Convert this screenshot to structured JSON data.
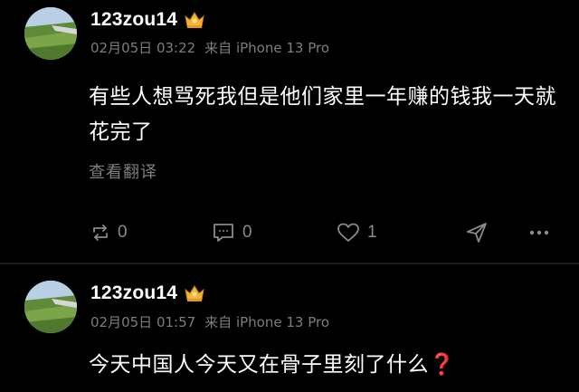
{
  "posts": [
    {
      "username": "123zou14",
      "date": "02月05日 03:22",
      "source": "来自 iPhone 13 Pro",
      "content": "有些人想骂死我但是他们家里一年赚的钱我一天就花完了",
      "translate_label": "查看翻译",
      "actions": {
        "repost_count": "0",
        "comment_count": "0",
        "like_count": "1"
      }
    },
    {
      "username": "123zou14",
      "date": "02月05日 01:57",
      "source": "来自 iPhone 13 Pro",
      "content": "今天中国人今天又在骨子里刻了什么",
      "content_emoji": "❓"
    }
  ],
  "icons": {
    "repost": "repost-icon",
    "comment": "comment-icon",
    "like": "heart-icon",
    "share": "share-icon",
    "more": "more-icon",
    "badge": "crown-badge-icon"
  },
  "colors": {
    "background": "#000000",
    "primary_text": "#ffffff",
    "secondary_text": "#7d7d7d",
    "crown_gold": "#f2b53a",
    "question_mark": "#e0393b"
  }
}
